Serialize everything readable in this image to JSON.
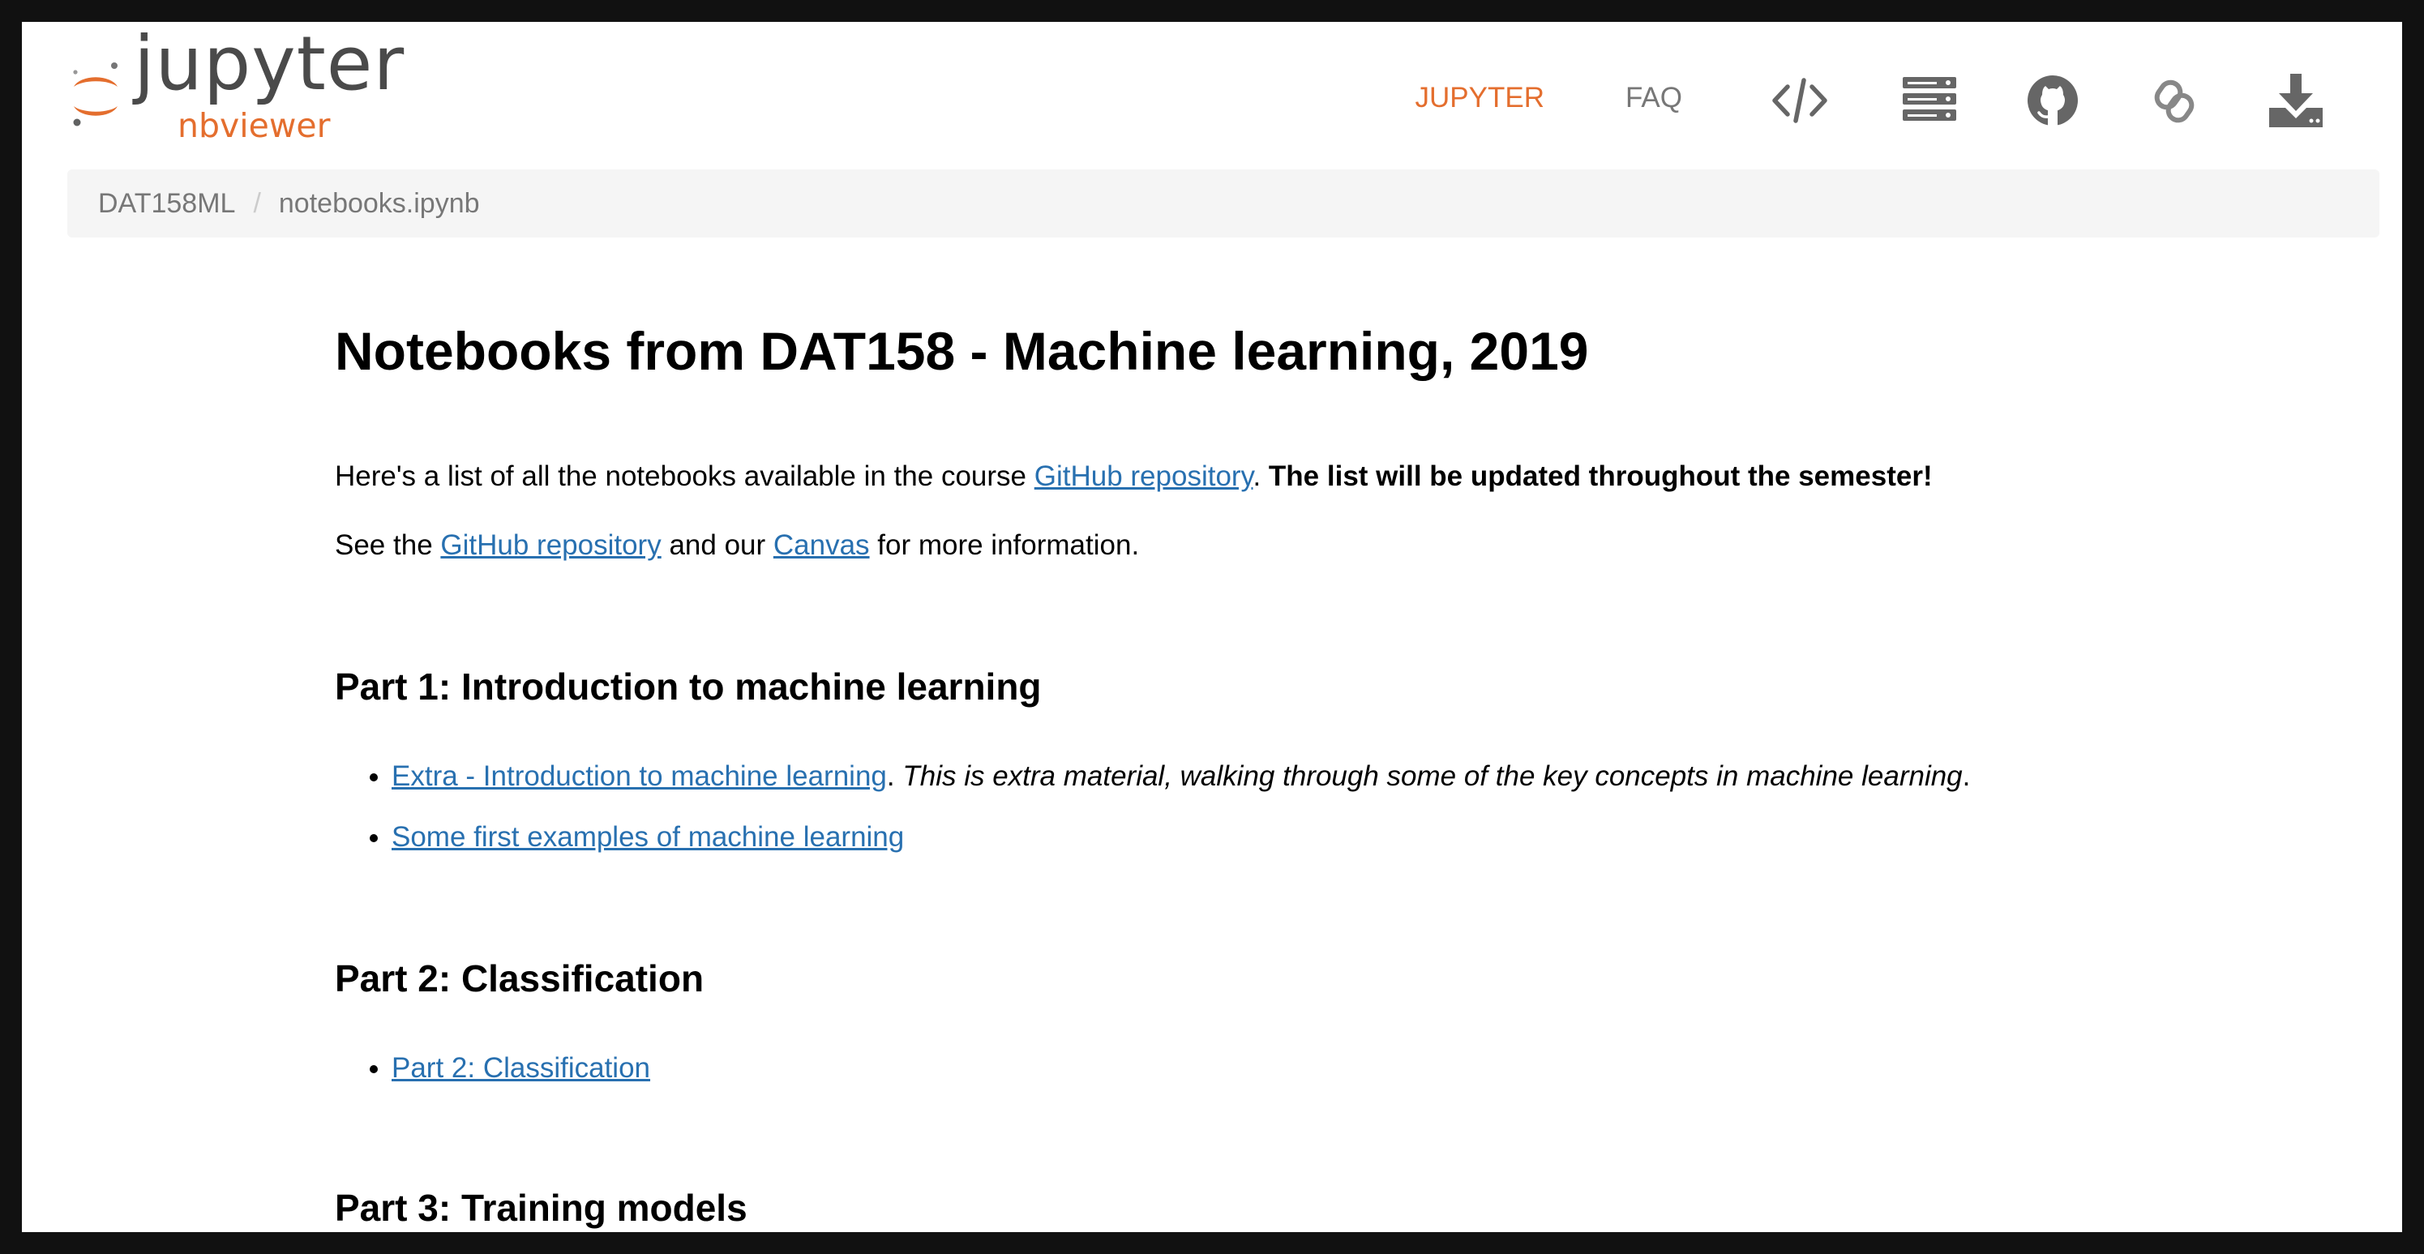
{
  "header": {
    "logo_word": "jupyter",
    "logo_sub": "nbviewer",
    "nav": {
      "jupyter_label": "JUPYTER",
      "faq_label": "FAQ"
    },
    "icons": [
      "code-icon",
      "server-icon",
      "github-icon",
      "chain-link-icon",
      "download-icon"
    ],
    "accent_color": "#e46e2e"
  },
  "breadcrumb": {
    "items": [
      "DAT158ML",
      "notebooks.ipynb"
    ],
    "separator": "/"
  },
  "content": {
    "title": "Notebooks from DAT158 - Machine learning, 2019",
    "para1": {
      "pre": "Here's a list of all the notebooks available in the course ",
      "link": "GitHub repository",
      "mid": ". ",
      "bold": "The list will be updated throughout the semester!"
    },
    "para2": {
      "pre": "See the ",
      "link1": "GitHub repository",
      "mid": " and our ",
      "link2": "Canvas",
      "post": " for more information."
    },
    "sections": [
      {
        "heading": "Part 1: Introduction to machine learning",
        "items": [
          {
            "link": "Extra - Introduction to machine learning",
            "sep": ". ",
            "note": "This is extra material, walking through some of the key concepts in machine learning",
            "end": "."
          },
          {
            "link": "Some first examples of machine learning"
          }
        ]
      },
      {
        "heading": "Part 2: Classification",
        "items": [
          {
            "link": "Part 2: Classification"
          }
        ]
      },
      {
        "heading": "Part 3: Training models",
        "items": []
      }
    ],
    "link_color": "#2870b0"
  }
}
